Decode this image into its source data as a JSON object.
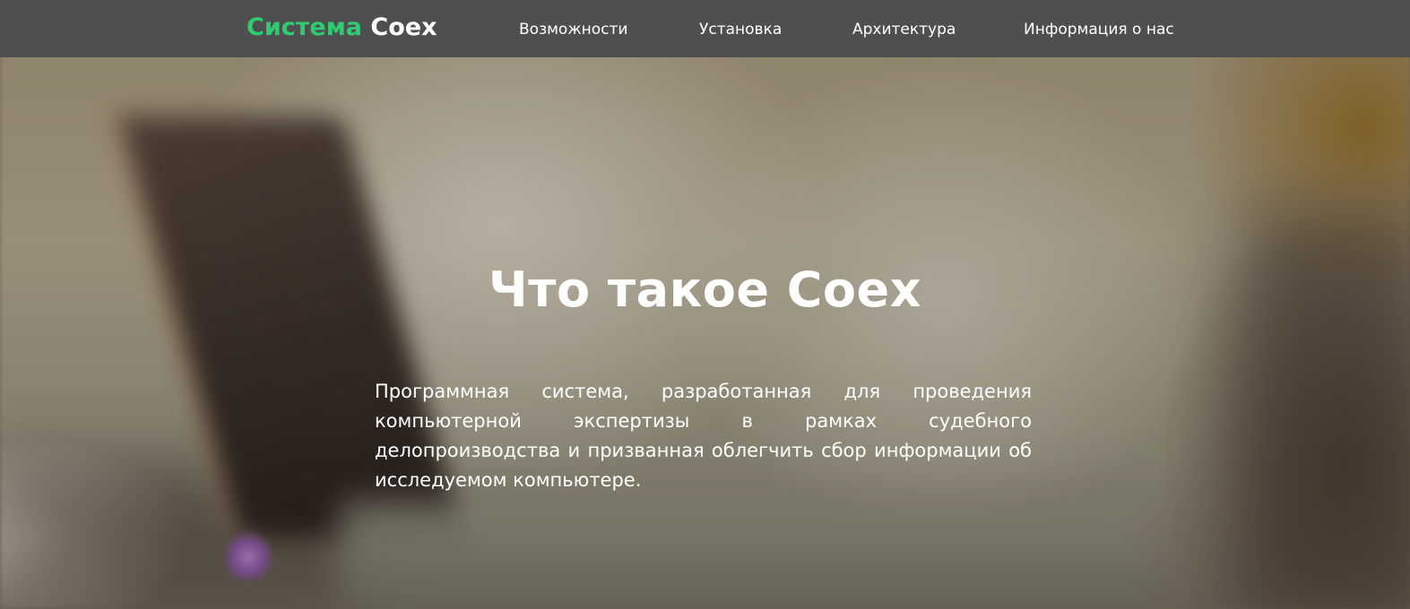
{
  "navbar": {
    "brand_accent": "Система",
    "brand_main": "Coex",
    "links": [
      {
        "label": "Возможности"
      },
      {
        "label": "Установка"
      },
      {
        "label": "Архитектура"
      },
      {
        "label": "Информация о нас"
      }
    ]
  },
  "hero": {
    "title": "Что такое Coex",
    "description": "Программная система, разработанная для проведения компьютерной экспертизы в рамках судебного делопроизводства и призванная облегчить сбор информации об исследуемом компьютере."
  },
  "colors": {
    "navbar_bg": "#4f4f4f",
    "brand_accent": "#2ecc71",
    "text": "#ffffff"
  }
}
